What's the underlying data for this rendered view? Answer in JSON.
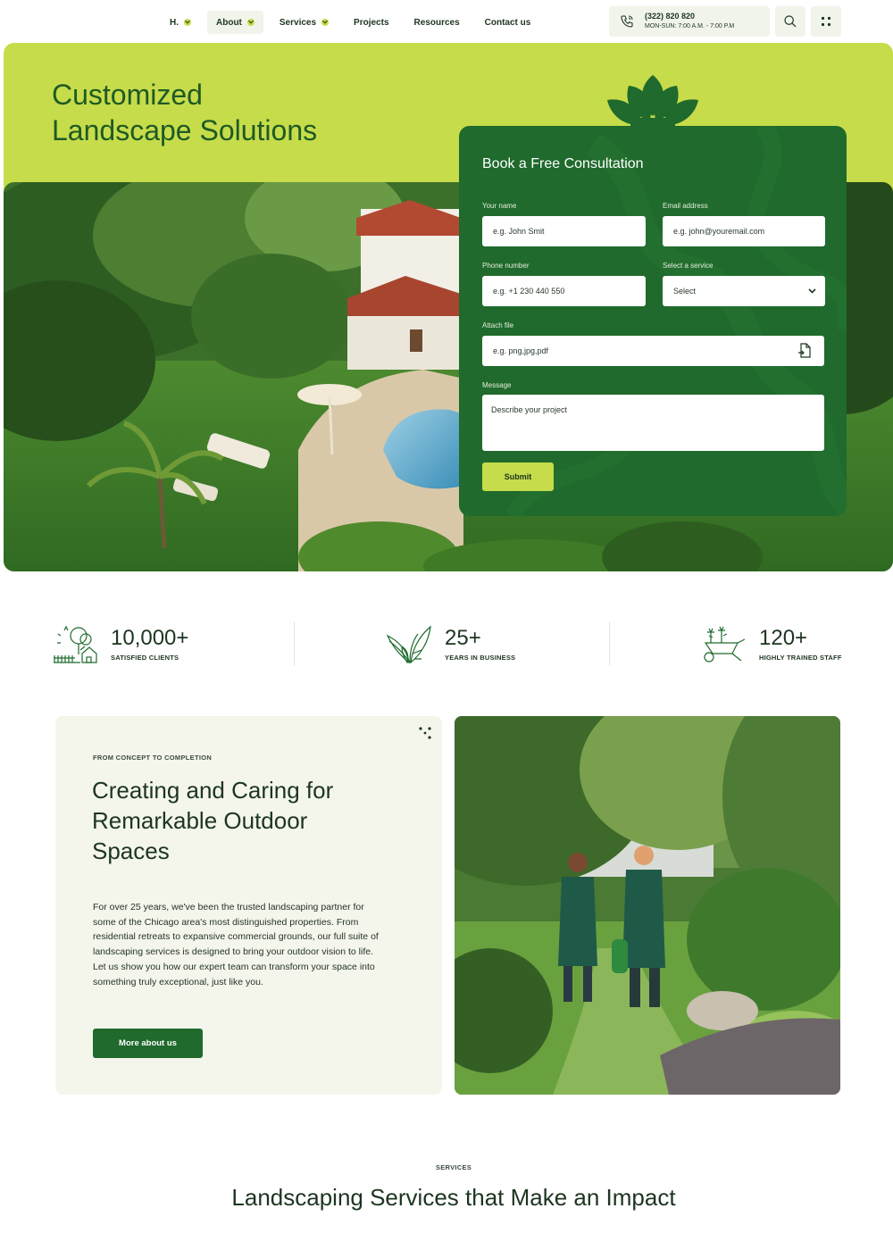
{
  "nav": {
    "items": [
      {
        "label": "H.",
        "dropdown": true,
        "active": false
      },
      {
        "label": "About",
        "dropdown": true,
        "active": true
      },
      {
        "label": "Services",
        "dropdown": true,
        "active": false
      },
      {
        "label": "Projects",
        "dropdown": false,
        "active": false
      },
      {
        "label": "Resources",
        "dropdown": false,
        "active": false
      },
      {
        "label": "Contact us",
        "dropdown": false,
        "active": false
      }
    ],
    "phone": "(322) 820 820",
    "hours": "MON-SUN: 7:00 A.M. - 7:00 P.M",
    "icons": [
      "phone-icon",
      "search-icon",
      "grid-menu-icon"
    ]
  },
  "hero": {
    "title_line1": "Customized",
    "title_line2": "Landscape Solutions"
  },
  "form": {
    "title": "Book a Free Consultation",
    "name_label": "Your name",
    "name_placeholder": "e.g. John Smit",
    "email_label": "Email address",
    "email_placeholder": "e.g. john@youremail.com",
    "phone_label": "Phone number",
    "phone_placeholder": "e.g. +1 230 440 550",
    "service_label": "Select a service",
    "service_value": "Select",
    "file_label": "Attach file",
    "file_placeholder": "e.g. png,jpg,pdf",
    "message_label": "Message",
    "message_placeholder": "Describe your project",
    "submit_label": "Submit"
  },
  "stats": [
    {
      "value": "10,000+",
      "label": "SATISFIED CLIENTS",
      "icon": "house-tree-icon"
    },
    {
      "value": "25+",
      "label": "YEARS IN BUSINESS",
      "icon": "plant-leaves-icon"
    },
    {
      "value": "120+",
      "label": "HIGHLY TRAINED STAFF",
      "icon": "wheelbarrow-icon"
    }
  ],
  "about": {
    "eyebrow": "FROM CONCEPT TO COMPLETION",
    "title": "Creating and Caring for Remarkable Outdoor Spaces",
    "body": "For over 25 years, we've been the trusted landscaping partner for some of the Chicago area's most distinguished properties. From residential retreats to expansive commercial grounds, our full suite of landscaping services is designed to bring your outdoor vision to life. Let us show you how our expert team can transform your space into something truly exceptional, just like you.",
    "button_label": "More about us"
  },
  "services": {
    "eyebrow": "SERVICES",
    "title": "Landscaping Services that Make an Impact"
  },
  "colors": {
    "lime": "#c6dc4a",
    "forest": "#1f6a2c",
    "dark_text": "#1d3520",
    "cream": "#f4f6ec"
  }
}
